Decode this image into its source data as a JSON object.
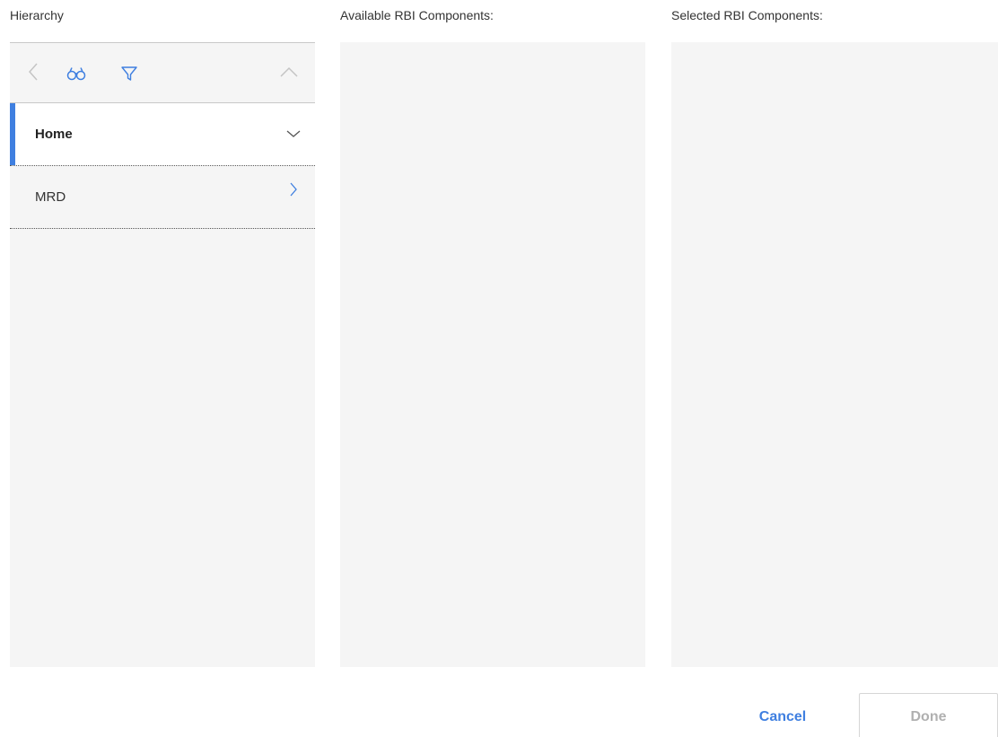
{
  "labels": {
    "hierarchy": "Hierarchy",
    "available": "Available RBI Components:",
    "selected": "Selected RBI Components:"
  },
  "toolbar": {
    "icons": [
      "back-icon",
      "binoculars-icon",
      "filter-icon",
      "collapse-icon"
    ]
  },
  "tree": {
    "items": [
      {
        "label": "Home",
        "state": "expanded",
        "active": true
      },
      {
        "label": "MRD",
        "state": "collapsed",
        "active": false
      }
    ]
  },
  "footer": {
    "cancel_label": "Cancel",
    "done_label": "Done"
  },
  "colors": {
    "accent": "#3f7fe0",
    "panel_bg": "#f5f5f5",
    "disabled_text": "#b0b0b0"
  }
}
